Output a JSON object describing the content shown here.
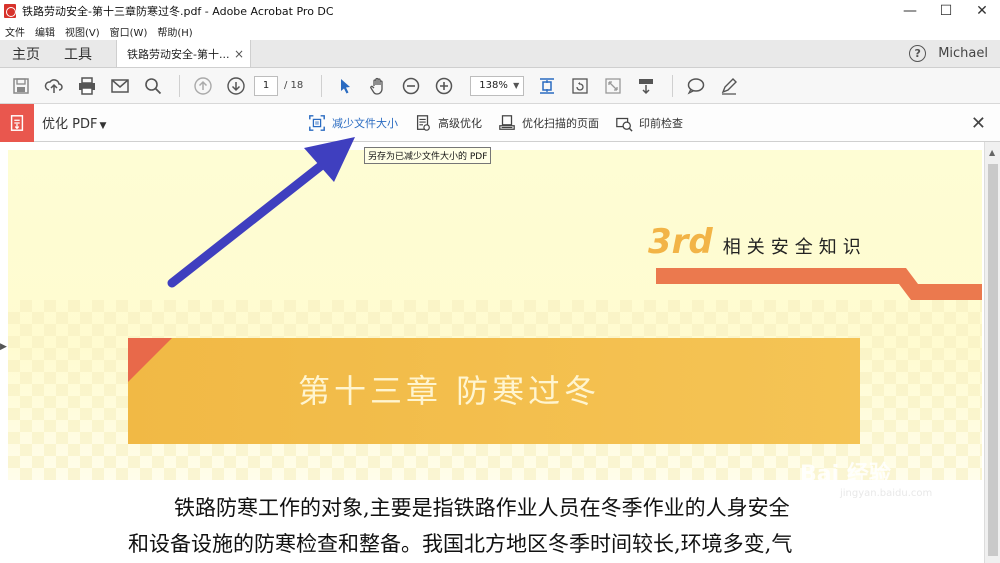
{
  "window": {
    "title": "铁路劳动安全-第十三章防寒过冬.pdf - Adobe Acrobat Pro DC",
    "minimize": "—",
    "maximize": "☐",
    "close": "✕"
  },
  "menu": [
    "文件",
    "编辑",
    "视图(V)",
    "窗口(W)",
    "帮助(H)"
  ],
  "tabs": {
    "home": "主页",
    "tools": "工具",
    "document": "铁路劳动安全-第十...",
    "document_close": "×",
    "help": "?",
    "user": "Michael"
  },
  "toolbar": {
    "page_current": "1",
    "page_total": "/ 18",
    "zoom": "138%"
  },
  "optimize": {
    "title": "优化 PDF",
    "tools": [
      {
        "label": "减少文件大小",
        "icon": "reduce-size-icon"
      },
      {
        "label": "高级优化",
        "icon": "advanced-optimize-icon"
      },
      {
        "label": "优化扫描的页面",
        "icon": "optimize-scanned-icon"
      },
      {
        "label": "印前检查",
        "icon": "preflight-icon"
      }
    ],
    "close": "✕",
    "tooltip": "另存为已减少文件大小的 PDF"
  },
  "page": {
    "section_num": "3rd",
    "section_label": "相关安全知识",
    "chapter_title": "第十三章 防寒过冬",
    "para_line1": "铁路防寒工作的对象,主要是指铁路作业人员在冬季作业的人身安全",
    "para_line2": "和设备设施的防寒检查和整备。我国北方地区冬季时间较长,环境多变,气"
  },
  "watermark": {
    "brand": "Bai 经验",
    "url": "jingyan.baidu.com"
  },
  "colors": {
    "accent": "#2a6bc1",
    "arrow": "#3f3fbf",
    "optimize_red": "#e9574e",
    "banner": "#f1b945"
  }
}
